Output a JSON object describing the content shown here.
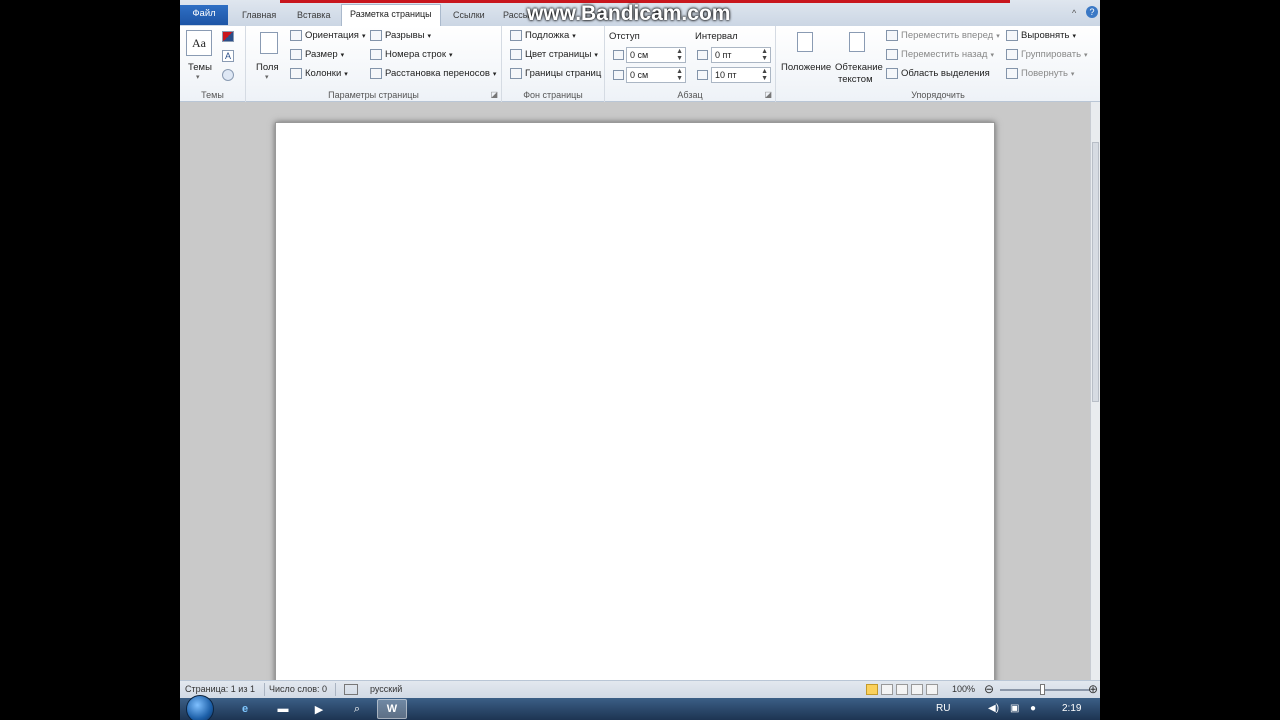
{
  "tabs": {
    "file": "Файл",
    "home": "Главная",
    "insert": "Вставка",
    "page_layout": "Разметка страницы",
    "references": "Ссылки",
    "mailings_partial": "Рассы"
  },
  "watermark": "www.Bandicam.com",
  "ribbon": {
    "themes": {
      "button": "Темы",
      "group_label": "Темы"
    },
    "page_setup": {
      "margins": "Поля",
      "orientation": "Ориентация",
      "size": "Размер",
      "columns": "Колонки",
      "breaks": "Разрывы",
      "line_numbers": "Номера строк",
      "hyphenation": "Расстановка переносов",
      "group_label": "Параметры страницы"
    },
    "page_background": {
      "watermark": "Подложка",
      "page_color": "Цвет страницы",
      "page_borders": "Границы страниц",
      "group_label": "Фон страницы"
    },
    "paragraph": {
      "indent_label": "Отступ",
      "indent_left": "0 см",
      "indent_right": "0 см",
      "spacing_label": "Интервал",
      "spacing_before": "0 пт",
      "spacing_after": "10 пт",
      "group_label": "Абзац"
    },
    "arrange": {
      "position": "Положение",
      "wrap_line1": "Обтекание",
      "wrap_line2": "текстом",
      "bring_forward": "Переместить вперед",
      "send_backward": "Переместить назад",
      "selection_pane": "Область выделения",
      "align": "Выровнять",
      "group": "Группировать",
      "rotate": "Повернуть",
      "group_label": "Упорядочить"
    }
  },
  "status": {
    "page": "Страница: 1 из 1",
    "words": "Число слов: 0",
    "language": "русский",
    "zoom": "100%",
    "zoom_level": 1.0
  },
  "taskbar": {
    "lang": "RU",
    "clock": "2:19"
  }
}
